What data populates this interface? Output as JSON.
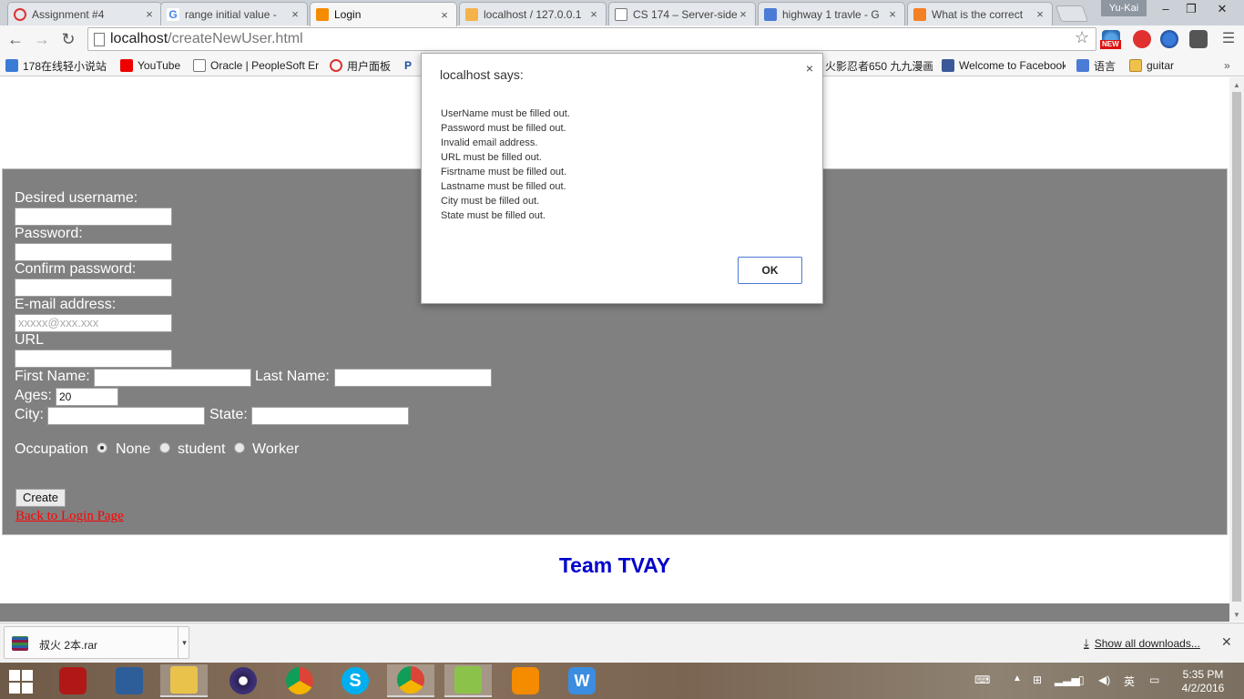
{
  "browser": {
    "tabs": [
      {
        "title": "Assignment #4",
        "active": false
      },
      {
        "title": "range initial value -",
        "active": false
      },
      {
        "title": "Login",
        "active": true
      },
      {
        "title": "localhost / 127.0.0.1",
        "active": false
      },
      {
        "title": "CS 174 – Server-side",
        "active": false
      },
      {
        "title": "highway 1 travle - G",
        "active": false
      },
      {
        "title": "What is the correct",
        "active": false
      }
    ],
    "profile_name": "Yu-Kai",
    "url_host": "localhost",
    "url_path": "/createNewUser.html",
    "bookmarks": [
      "178在线轻小说站",
      "YouTube",
      "Oracle | PeopleSoft Er",
      "用户面板",
      "P",
      "火影忍者650 九九漫画",
      "Welcome to Facebook",
      "语言",
      "guitar"
    ],
    "ext_new_badge": "NEW"
  },
  "form": {
    "username_label": "Desired username:",
    "password_label": "Password:",
    "confirm_label": "Confirm password:",
    "email_label": "E-mail address:",
    "email_placeholder": "xxxxx@xxx.xxx",
    "url_label": "URL",
    "firstname_label": "First Name:",
    "lastname_label": "Last Name:",
    "ages_label": "Ages:",
    "ages_value": "20",
    "city_label": "City:",
    "state_label": "State:",
    "occupation_label": "Occupation",
    "occupation_options": [
      "None",
      "student",
      "Worker"
    ],
    "occupation_selected": "None",
    "create_button": "Create",
    "back_link": "Back to Login Page"
  },
  "footer_text": "Team TVAY",
  "dialog": {
    "title": "localhost says:",
    "close": "×",
    "messages": [
      "UserName must be filled out.",
      "Password must be filled out.",
      "Invalid email address.",
      "URL must be filled out.",
      "Fisrtname must be filled out.",
      "Lastname must be filled out.",
      "City must be filled out.",
      "State must be filled out."
    ],
    "ok_label": "OK"
  },
  "downloads": {
    "file_name": "叔火 2本.rar",
    "show_all": "Show all downloads..."
  },
  "taskbar": {
    "clock_time": "5:35 PM",
    "clock_date": "4/2/2016",
    "ime": "英"
  }
}
